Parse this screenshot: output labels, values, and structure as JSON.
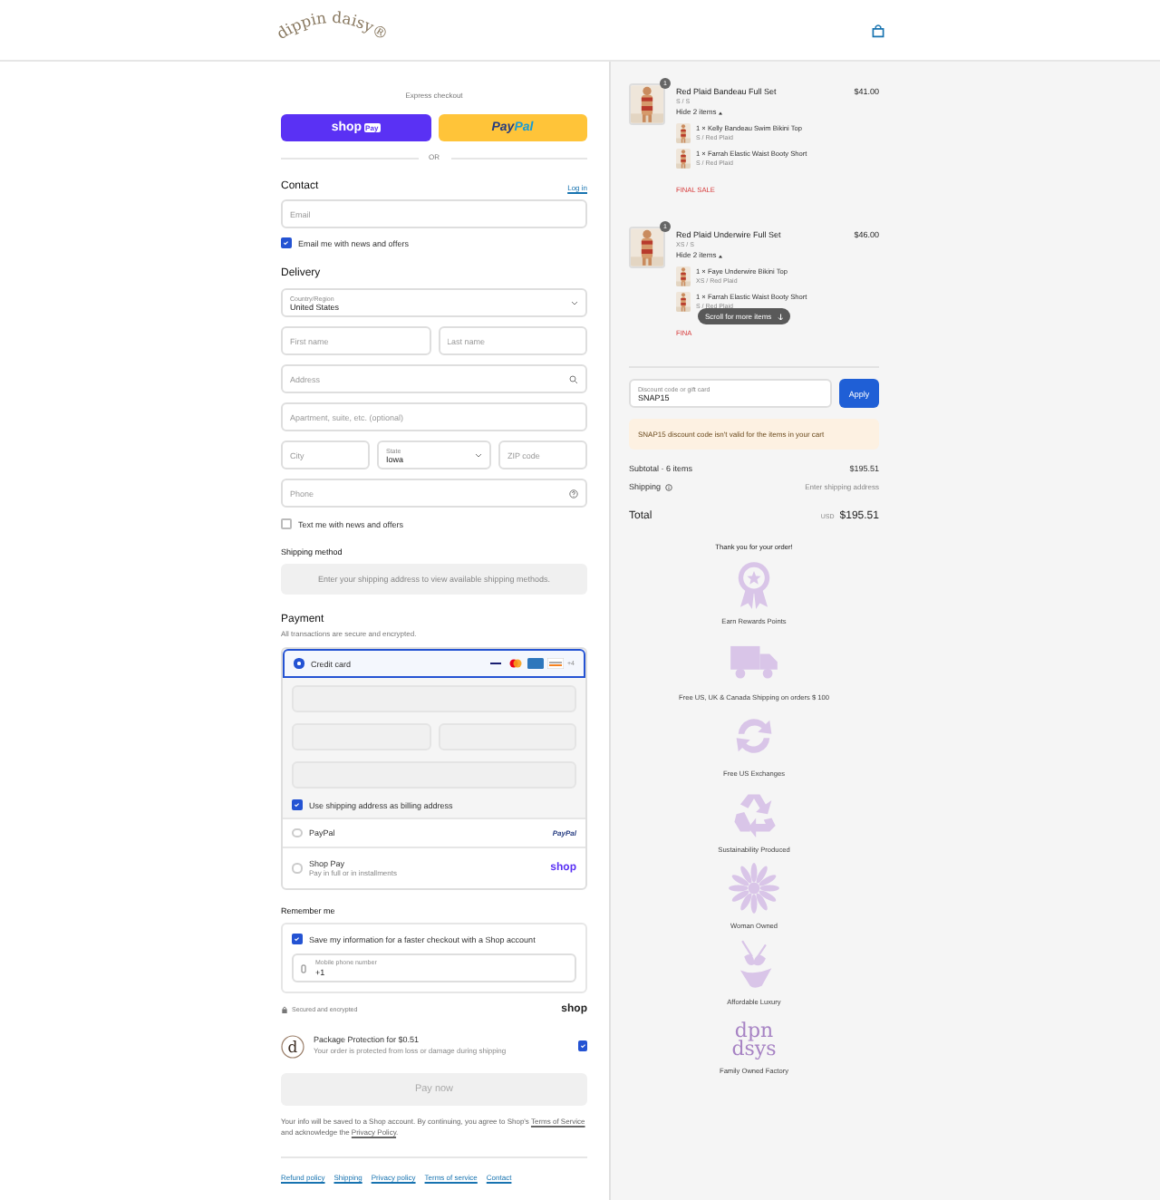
{
  "header": {
    "logo": "dippin daisy®"
  },
  "express": {
    "title": "Express checkout",
    "shop_pay": {
      "label": "shop",
      "badge": "Pay"
    },
    "paypal": {
      "parts": [
        "Pay",
        "Pal"
      ]
    },
    "divider": "OR"
  },
  "contact": {
    "title": "Contact",
    "link": "Log in",
    "email": {
      "kind": "text",
      "placeholder": "Email"
    },
    "news": {
      "label": "Email me with news and offers",
      "checked": true
    }
  },
  "delivery": {
    "title": "Delivery",
    "rows": [
      [
        {
          "kind": "select",
          "label": "Country/Region",
          "value": "United States"
        }
      ],
      [
        {
          "kind": "text",
          "placeholder": "First name"
        },
        {
          "kind": "text",
          "placeholder": "Last name"
        }
      ],
      [
        {
          "kind": "search",
          "placeholder": "Address"
        }
      ],
      [
        {
          "kind": "text",
          "placeholder": "Apartment, suite, etc. (optional)"
        }
      ],
      [
        {
          "kind": "text",
          "placeholder": "City"
        },
        {
          "kind": "select",
          "label": "State",
          "value": "Iowa"
        },
        {
          "kind": "text",
          "placeholder": "ZIP code"
        }
      ],
      [
        {
          "kind": "help",
          "placeholder": "Phone"
        }
      ]
    ],
    "sms": {
      "label": "Text me with news and offers",
      "checked": false
    }
  },
  "shipping": {
    "title": "Shipping method",
    "message": "Enter your shipping address to view available shipping methods."
  },
  "payment": {
    "title": "Payment",
    "subtitle": "All transactions are secure and encrypted.",
    "options": [
      {
        "kind": "cards",
        "label": "Credit card",
        "selected": true,
        "more": "+4",
        "billing": {
          "label": "Use shipping address as billing address",
          "checked": true
        }
      },
      {
        "kind": "paypal",
        "label": "PayPal",
        "selected": false,
        "logo_text": "PayPal"
      },
      {
        "kind": "shop",
        "label": "Shop Pay",
        "sub": "Pay in full or in installments",
        "selected": false,
        "logo_text": "shop"
      }
    ]
  },
  "remember": {
    "title": "Remember me",
    "save": {
      "label": "Save my information for a faster checkout with a Shop account",
      "checked": true
    },
    "phone": {
      "label": "Mobile phone number",
      "value": "+1"
    },
    "secure": "Secured and encrypted",
    "shop": "shop"
  },
  "protection": {
    "logo_text": "d",
    "title": "Package Protection for $0.51",
    "text": "Your order is protected from loss or damage during shipping",
    "checked": true
  },
  "pay_button": {
    "label": "Pay now",
    "disabled": true
  },
  "consent": [
    {
      "text": "Your info will be saved to a Shop account. By continuing, you agree to Shop's "
    },
    {
      "link": "Terms of Service"
    },
    {
      "text": " and acknowledge the "
    },
    {
      "link": "Privacy Policy"
    },
    {
      "text": "."
    }
  ],
  "footer_links": [
    "Refund policy",
    "Shipping",
    "Privacy policy",
    "Terms of service",
    "Contact"
  ],
  "cart": {
    "items": [
      {
        "quantity": "1",
        "name": "Red Plaid Bandeau Full Set",
        "variant": "S / S",
        "price": "$41.00",
        "toggle": "Hide 2 items",
        "expanded": true,
        "parts": [
          {
            "name": "1 × Kelly Bandeau Swim Bikini Top",
            "variant": "S / Red Plaid"
          },
          {
            "name": "1 × Farrah Elastic Waist Booty Short",
            "variant": "S / Red Plaid"
          }
        ],
        "note": "FINAL SALE"
      },
      {
        "quantity": "1",
        "name": "Red Plaid Underwire Full Set",
        "variant": "XS / S",
        "price": "$46.00",
        "toggle": "Hide 2 items",
        "expanded": true,
        "parts": [
          {
            "name": "1 × Faye Underwire Bikini Top",
            "variant": "XS / Red Plaid"
          },
          {
            "name": "1 × Farrah Elastic Waist Booty Short",
            "variant": "S / Red Plaid"
          }
        ],
        "note": "FINA"
      }
    ],
    "scroll_hint": "Scroll for more items",
    "discount": {
      "label": "Discount code or gift card",
      "value": "SNAP15",
      "button": "Apply"
    },
    "warning": "SNAP15 discount code isn't valid for the items in your cart",
    "subtotal": {
      "label": "Subtotal · 6 items",
      "value": "$195.51"
    },
    "shipping": {
      "label": "Shipping",
      "value": "Enter shipping address"
    },
    "total": {
      "label": "Total",
      "currency": "USD",
      "value": "$195.51"
    }
  },
  "perks": {
    "title": "Thank you for your order!",
    "items": [
      {
        "kind": "badge",
        "label": "Earn Rewards Points"
      },
      {
        "kind": "truck",
        "label": "Free US, UK & Canada Shipping on orders $ 100"
      },
      {
        "kind": "arrows",
        "label": "Free US Exchanges"
      },
      {
        "kind": "recycle",
        "label": "Sustainability Produced"
      },
      {
        "kind": "flower",
        "label": "Woman Owned"
      },
      {
        "kind": "bikini",
        "label": "Affordable Luxury"
      },
      {
        "kind": "monogram",
        "lines": [
          "dpn",
          "dsys"
        ],
        "label": "Family Owned Factory"
      }
    ]
  }
}
